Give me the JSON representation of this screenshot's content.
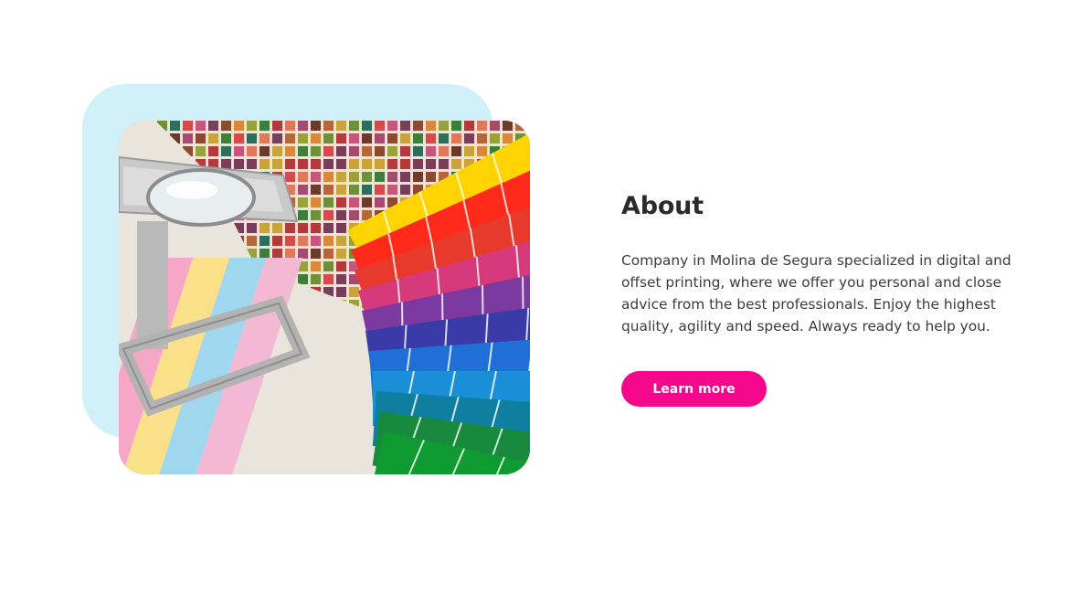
{
  "about": {
    "title": "About",
    "body": "Company in Molina de Segura specialized in digital and offset printing, where we offer you personal and close advice from the best professionals. Enjoy the highest quality, agility and speed. Always ready to help you.",
    "button_label": "Learn more"
  },
  "image": {
    "subject": "printing-color-swatches-and-loupe"
  },
  "colors": {
    "accent": "#f5078b",
    "shape_bg": "#d1f1fa",
    "title": "#2b2b2b",
    "text": "#3c3c3c"
  }
}
